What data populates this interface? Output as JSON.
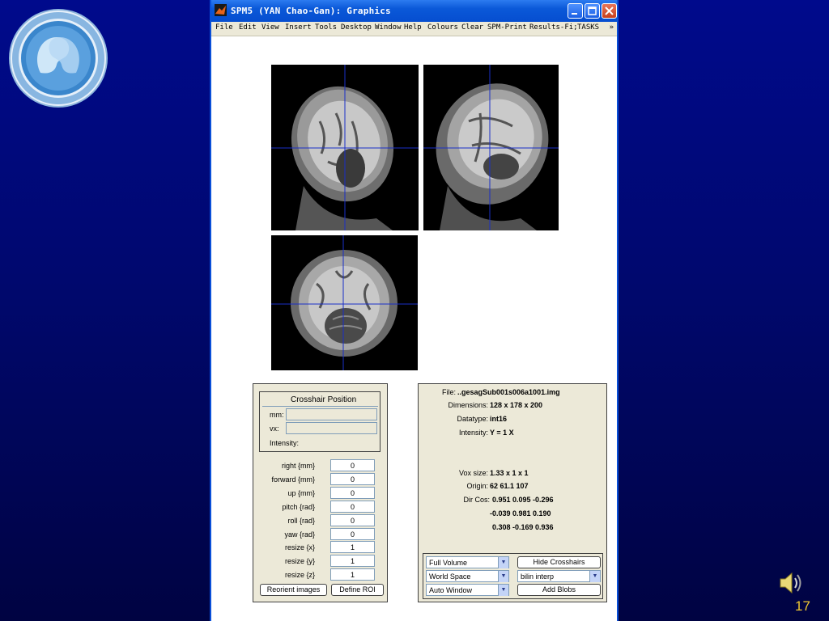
{
  "slide": {
    "number": "17"
  },
  "window": {
    "title": "SPM5 (YAN Chao-Gan): Graphics",
    "menu": [
      "File",
      "Edit",
      "View",
      "Insert",
      "Tools",
      "Desktop",
      "Window",
      "Help",
      "Colours",
      "Clear",
      "SPM-Print",
      "Results-Fi;",
      "TASKS"
    ]
  },
  "crosshair": {
    "heading": "Crosshair Position",
    "mm_label": "mm:",
    "vx_label": "vx:",
    "intensity_label": "Intensity:"
  },
  "params": [
    {
      "label": "right  {mm}",
      "value": "0"
    },
    {
      "label": "forward  {mm}",
      "value": "0"
    },
    {
      "label": "up  {mm}",
      "value": "0"
    },
    {
      "label": "pitch  {rad}",
      "value": "0"
    },
    {
      "label": "roll  {rad}",
      "value": "0"
    },
    {
      "label": "yaw  {rad}",
      "value": "0"
    },
    {
      "label": "resize  {x}",
      "value": "1"
    },
    {
      "label": "resize  {y}",
      "value": "1"
    },
    {
      "label": "resize  {z}",
      "value": "1"
    }
  ],
  "buttons": {
    "reorient": "Reorient images",
    "define_roi": "Define ROI",
    "hide_crosshairs": "Hide Crosshairs",
    "add_blobs": "Add Blobs"
  },
  "info": {
    "file_label": "File:",
    "file_value": "..gesagSub001s006a1001.img",
    "dim_label": "Dimensions:",
    "dim_value": "128 x 178 x 200",
    "dtype_label": "Datatype:",
    "dtype_value": "int16",
    "intensity_label": "Intensity:",
    "intensity_value": "Y = 1 X",
    "vox_label": "Vox size:",
    "vox_value": "1.33 x 1 x 1",
    "origin_label": "Origin:",
    "origin_value": "62 61.1 107",
    "dircos_label": "Dir Cos:",
    "dircos_row1": "0.951  0.095 -0.296",
    "dircos_row2": "-0.039  0.981  0.190",
    "dircos_row3": "0.308 -0.169  0.936"
  },
  "selects": {
    "volume": "Full Volume",
    "space": "World Space",
    "window": "Auto Window",
    "interp": "bilin interp"
  },
  "colors": {
    "titlebar": "#0a58d8",
    "panel": "#ece9d8",
    "crosshair": "#1a2fc8",
    "slide_bg": "#000a8c",
    "slide_number": "#f0c830"
  }
}
